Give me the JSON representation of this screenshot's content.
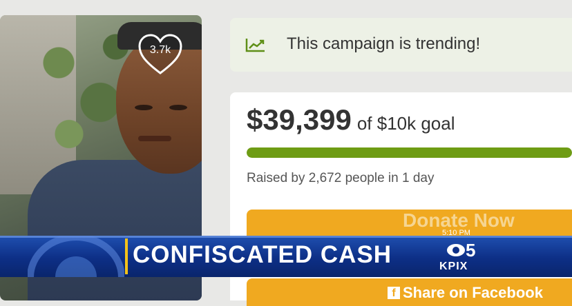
{
  "photo": {
    "like_count": "3.7k"
  },
  "trending": {
    "text": "This campaign is trending!",
    "icon": "trend-chart-icon",
    "icon_color": "#5f8f17",
    "background": "#edf1e6"
  },
  "campaign": {
    "amount": "$39,399",
    "goal_text": "of $10k goal",
    "progress_fraction": 1.0,
    "progress_color": "#6e9c14",
    "raised_text": "Raised by 2,672 people in 1 day",
    "donate_label": "Donate Now",
    "share_label": "Share on Facebook",
    "button_color": "#f0a920"
  },
  "broadcast": {
    "headline": "CONFISCATED CASH",
    "station_number": "5",
    "station_call": "KPIX",
    "time": "5:10 PM",
    "bar_color": "#0d2f86",
    "accent_color": "#f4c21a"
  }
}
